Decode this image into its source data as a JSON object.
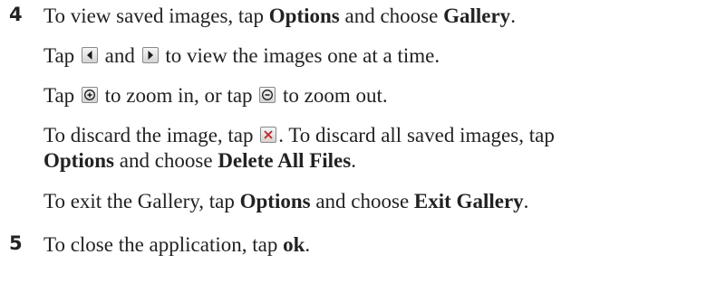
{
  "steps": [
    {
      "number": "4",
      "main": {
        "t1": "To view saved images, tap ",
        "b1": "Options",
        "t2": " and choose ",
        "b2": "Gallery",
        "t3": "."
      },
      "nav": {
        "t1": "Tap ",
        "t2": " and ",
        "t3": " to view the images one at a time."
      },
      "zoom": {
        "t1": "Tap ",
        "t2": " to zoom in, or tap ",
        "t3": " to zoom out."
      },
      "discard": {
        "t1": "To discard the image, tap ",
        "t2": ". To discard all saved images, tap",
        "b1": "Options",
        "t3": " and choose ",
        "b2": "Delete All Files",
        "t4": "."
      },
      "exit": {
        "t1": "To exit the Gallery, tap ",
        "b1": "Options",
        "t2": " and choose ",
        "b2": "Exit Gallery",
        "t3": "."
      }
    },
    {
      "number": "5",
      "main": {
        "t1": "To close the application, tap ",
        "b1": "ok",
        "t2": "."
      }
    }
  ],
  "icons": {
    "previous": "chevron-left-icon",
    "next": "chevron-right-icon",
    "zoom_in": "zoom-in-icon",
    "zoom_out": "zoom-out-icon",
    "delete": "delete-x-icon"
  },
  "colors": {
    "text": "#222222",
    "icon_glyph": "#1a1a1a",
    "delete_glyph": "#d02020"
  }
}
